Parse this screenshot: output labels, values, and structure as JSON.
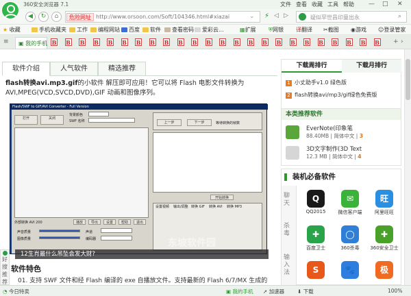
{
  "browser": {
    "title": "360安全浏览器 7.1",
    "menu": [
      "文件",
      "查看",
      "收藏",
      "工具",
      "帮助"
    ],
    "window_controls": [
      "—",
      "□",
      "✕"
    ],
    "danger_badge": "危险网址",
    "url": "http://www.orsoon.com/Soft/104346.html#xiazai",
    "search_placeholder": "疑似罕世昌印童出永",
    "bookmarks_left": [
      "收藏",
      "手机收藏夹",
      "工作",
      "编程网站",
      "百度",
      "软件",
      "查看密码",
      "爱彩云..."
    ],
    "bookmarks_right": [
      "扩展",
      "网银",
      "翻译",
      "截图",
      "游戏",
      "登录管家"
    ],
    "active_tab": "我的手机",
    "tab_icon_count": 24
  },
  "page": {
    "tabs": [
      "软件介绍",
      "人气软件",
      "精选推荐"
    ],
    "intro_bold": "flash转换avi.mp3.gif",
    "intro_text": "的小软件 解压即可应用！它可以将 Flash 电影文件转换为AVI,MPEG(VCD,SVCD,DVD),GIF 动画和图像序列。",
    "screenshot": {
      "title": "Flash/SWF to GIF/AVI Converter - Full Version",
      "buttons": [
        "打开",
        "关闭",
        "播放",
        "导出",
        "设置",
        "帮助",
        "退出",
        "上一步",
        "下一步",
        "开始转换"
      ],
      "labels": [
        "背景颜色",
        "SWF 名称",
        "SWF 文件",
        "等待转换的帧数",
        "外部转换 AVI 200",
        "声音质量",
        "图像质量",
        "声道",
        "编码器"
      ],
      "panel_tabs": [
        "设置视频",
        "输出/调整",
        "转换 GIF",
        "转换 AVI",
        "转换 MP3"
      ],
      "watermark": "东坡软件园"
    },
    "caption": "12生肖最什么吊坠会发大财?",
    "feature_title": "软件特色",
    "feature_1": "01. 支持 SWF 文件和经 Flash 编译的 exe 自播放文件。支持最新的 Flash 6/7/MX 生成的",
    "feedback": "好搜推荐"
  },
  "ranking": {
    "tabs": [
      "下载周排行",
      "下载月排行"
    ],
    "items": [
      {
        "num": "1",
        "name": "小丈助手v1.0 绿色版"
      },
      {
        "num": "2",
        "name": "flash转换avi/mp3/gif绿色免费版"
      }
    ]
  },
  "recommend": {
    "title": "本类推荐软件",
    "items": [
      {
        "name": "EverNote(印象笔",
        "size": "88.40MB",
        "lang": "简体中文",
        "score": "3"
      },
      {
        "name": "3D文字制作(3D Text",
        "size": "12.3 MB",
        "lang": "简体中文",
        "score": "4"
      }
    ]
  },
  "must": {
    "title": "装机必备软件",
    "side_categories": [
      "聊天",
      "杀毒",
      "输入法"
    ],
    "apps": [
      {
        "name": "QQ2015",
        "icon": "qq-icon",
        "color": "#1a1a1a",
        "glyph": "Q"
      },
      {
        "name": "微信客户端",
        "icon": "wechat-icon",
        "color": "#3bb33b",
        "glyph": "✉"
      },
      {
        "name": "阿里旺旺",
        "icon": "aliwangwang-icon",
        "color": "#2a8fe0",
        "glyph": "旺"
      },
      {
        "name": "百度卫士",
        "icon": "baidu-guard-icon",
        "color": "#2aa44a",
        "glyph": "✚"
      },
      {
        "name": "360杀毒",
        "icon": "360-antivirus-icon",
        "color": "#2f7fd6",
        "glyph": "◯"
      },
      {
        "name": "360安全卫士",
        "icon": "360-safe-icon",
        "color": "#4aa12a",
        "glyph": "✚"
      },
      {
        "name": "",
        "icon": "sogou-input-icon",
        "color": "#e8581a",
        "glyph": "S"
      },
      {
        "name": "",
        "icon": "baidu-input-icon",
        "color": "#2e7ee0",
        "glyph": "🐾"
      },
      {
        "name": "",
        "icon": "ji-input-icon",
        "color": "#f06a22",
        "glyph": "极"
      }
    ]
  },
  "statusbar": {
    "left": "今日特卖",
    "items": [
      "我的手机",
      "加速器",
      "下载",
      "100%"
    ]
  },
  "colors": {
    "accent": "#2e9a2e",
    "danger": "#d62020"
  }
}
